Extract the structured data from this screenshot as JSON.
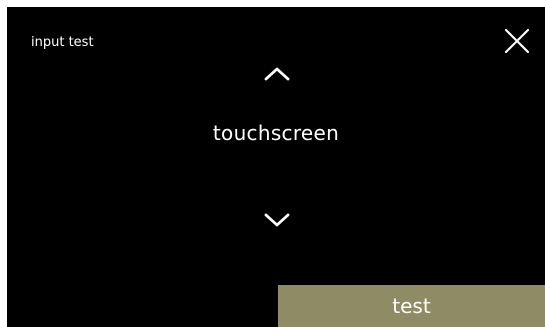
{
  "header": {
    "title": "input test",
    "close_icon": "close-icon"
  },
  "selector": {
    "up_icon": "chevron-up-icon",
    "selected_value": "touchscreen",
    "down_icon": "chevron-down-icon"
  },
  "footer": {
    "test_label": "test"
  },
  "colors": {
    "background": "#000000",
    "text": "#ffffff",
    "accent": "#8f8b64"
  }
}
